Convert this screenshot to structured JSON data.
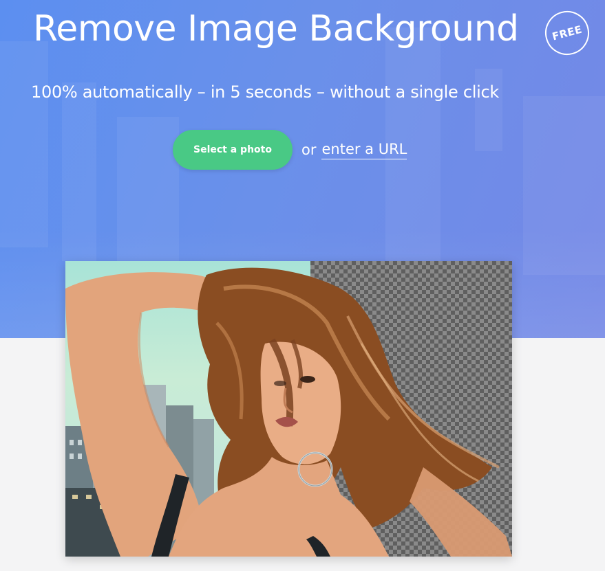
{
  "header": {
    "title": "Remove Image Background",
    "badge": "FREE",
    "subtitle": "100% automatically – in 5 seconds – without a single click"
  },
  "actions": {
    "select_photo_label": "Select a photo",
    "or_text": "or",
    "enter_url_label": "enter a URL"
  },
  "colors": {
    "hero_gradient_start": "#5c8ff0",
    "hero_gradient_end": "#7488e6",
    "button_green": "#49c985",
    "page_background": "#f4f4f5"
  },
  "demo_image": {
    "description_icon": "person-photo-background-removed"
  }
}
